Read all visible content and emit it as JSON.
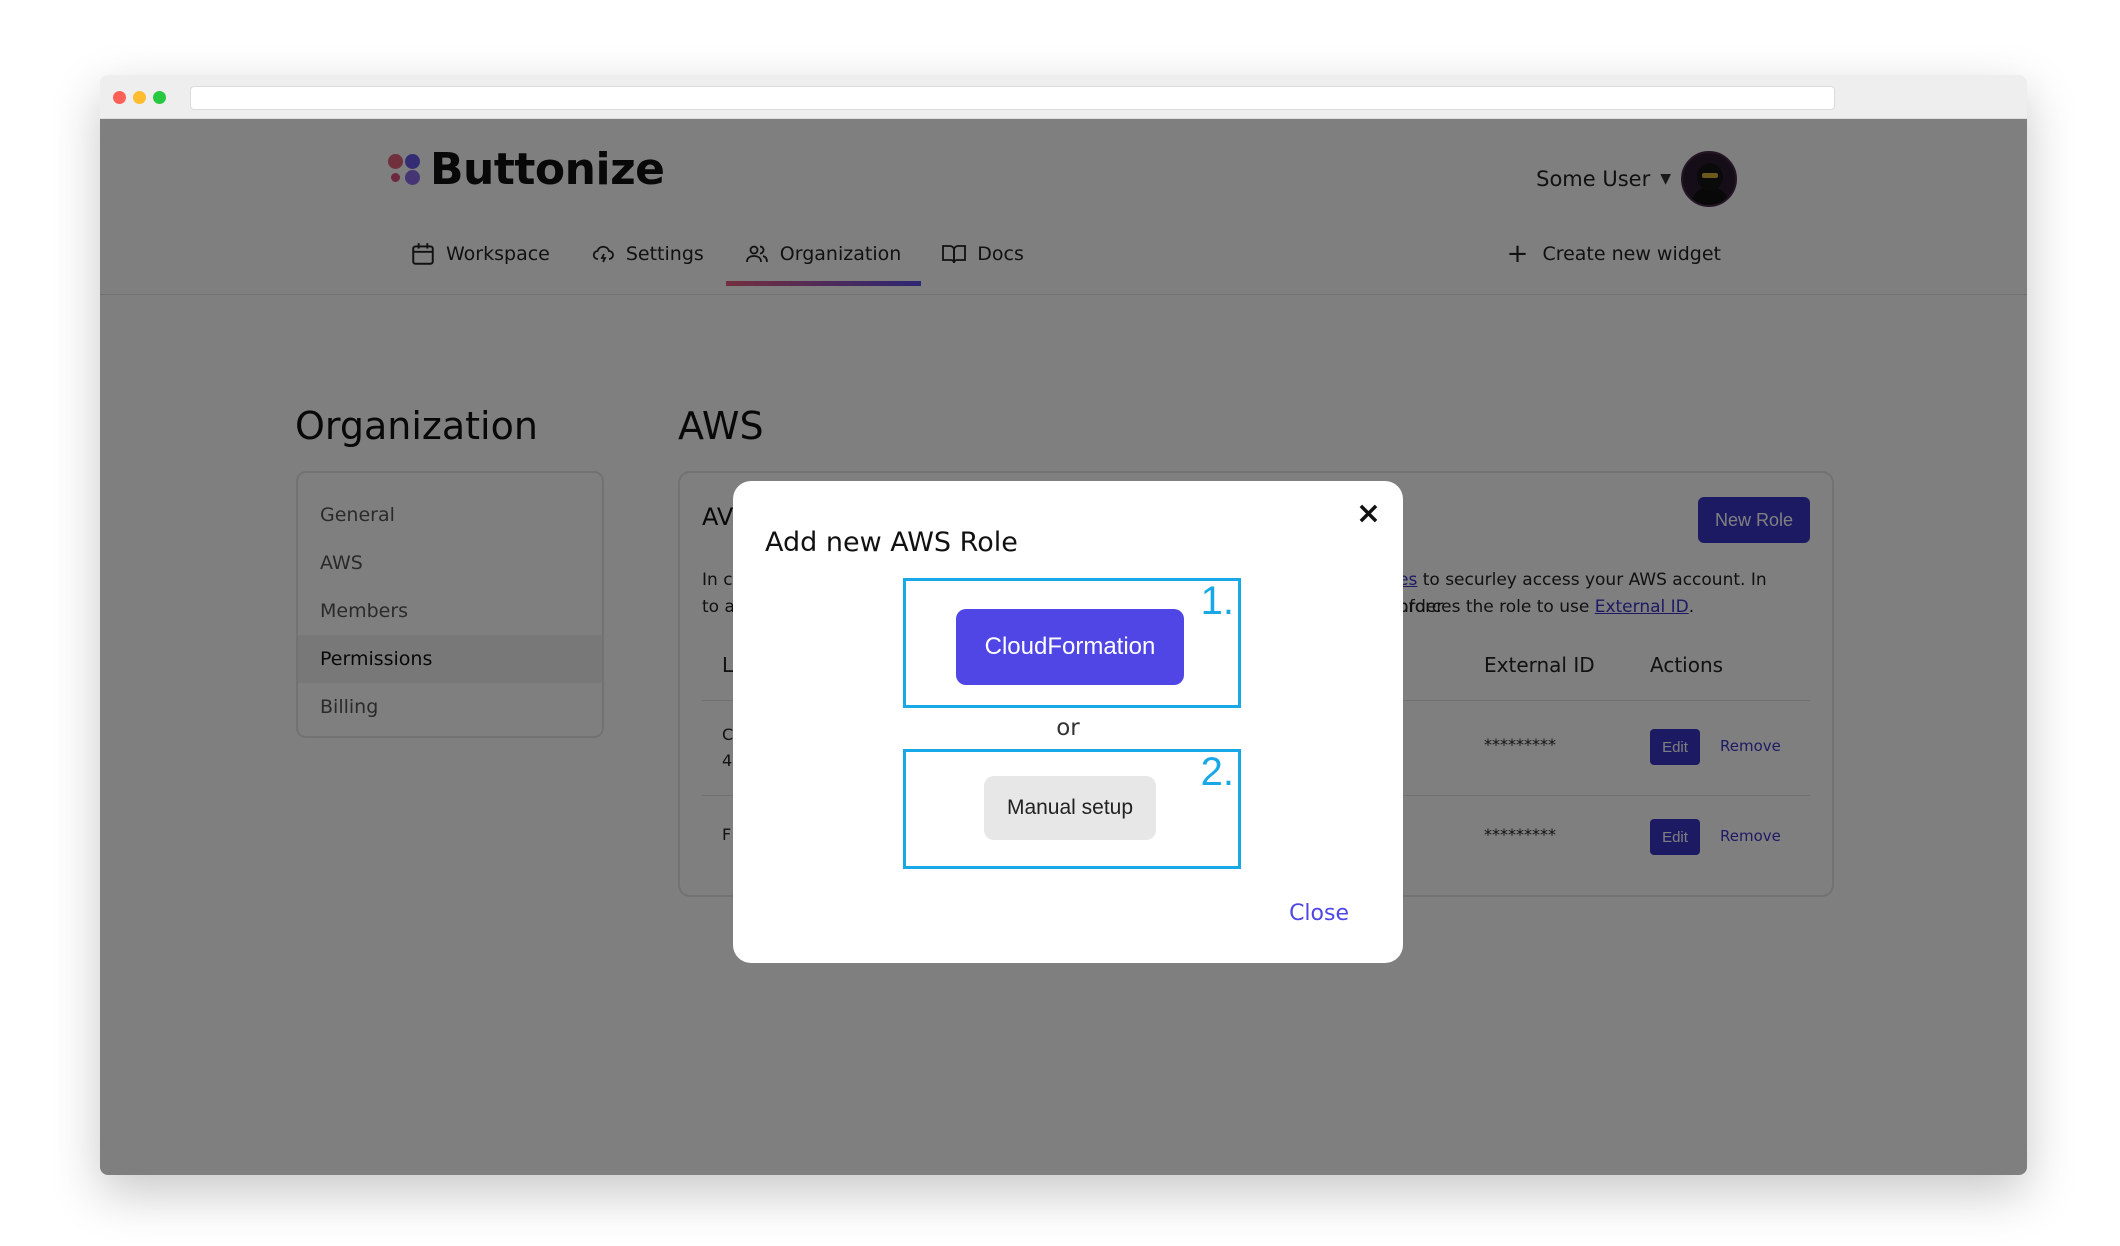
{
  "app": {
    "logo_text": "Buttonize",
    "user_name": "Some User",
    "nav": [
      {
        "label": "Workspace",
        "icon": "calendar-icon"
      },
      {
        "label": "Settings",
        "icon": "cloud-icon"
      },
      {
        "label": "Organization",
        "icon": "users-icon",
        "active": true
      },
      {
        "label": "Docs",
        "icon": "book-icon"
      }
    ],
    "create_label": "Create new widget"
  },
  "sidebar": {
    "title": "Organization",
    "items": [
      "General",
      "AWS",
      "Members",
      "Permissions",
      "Billing"
    ],
    "active_index": 3
  },
  "main": {
    "title": "AWS",
    "card_title_visible": "AV",
    "new_role_label": "New Role",
    "desc_line1_left": "In c",
    "desc_line1_link": "es",
    "desc_line1_right": " to securley access your AWS account. In order",
    "desc_line2_left": "to a",
    "desc_line2_right": "nforces the role to use ",
    "desc_line2_link": "External ID",
    "desc_line2_end": ".",
    "columns": {
      "first_partial": "L",
      "external_id": "External ID",
      "actions": "Actions"
    },
    "rows": [
      {
        "partial_a": "C",
        "partial_b": "4",
        "external_id": "*********",
        "edit": "Edit",
        "remove": "Remove"
      },
      {
        "partial_a": "F",
        "external_id": "*********",
        "edit": "Edit",
        "remove": "Remove"
      }
    ]
  },
  "modal": {
    "title": "Add new AWS Role",
    "close_x": "×",
    "step1_num": "1.",
    "step1_button": "CloudFormation",
    "or_text": "or",
    "step2_num": "2.",
    "step2_button": "Manual setup",
    "close_label": "Close"
  },
  "colors": {
    "accent": "#4f46e5",
    "accent_dark": "#3b34c9",
    "highlight_box": "#18a8e8",
    "overlay": "rgba(0,0,0,0.5)"
  }
}
